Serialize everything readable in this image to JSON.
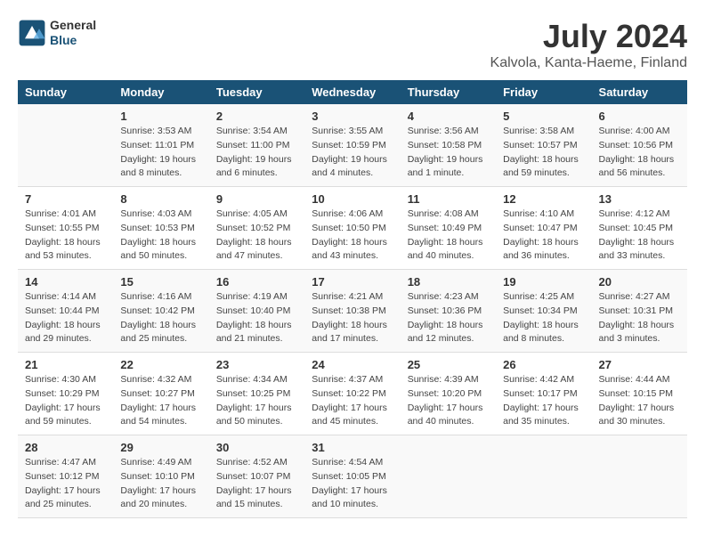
{
  "header": {
    "logo_general": "General",
    "logo_blue": "Blue",
    "month_title": "July 2024",
    "location": "Kalvola, Kanta-Haeme, Finland"
  },
  "days_of_week": [
    "Sunday",
    "Monday",
    "Tuesday",
    "Wednesday",
    "Thursday",
    "Friday",
    "Saturday"
  ],
  "weeks": [
    [
      {
        "day": "",
        "info": ""
      },
      {
        "day": "1",
        "info": "Sunrise: 3:53 AM\nSunset: 11:01 PM\nDaylight: 19 hours\nand 8 minutes."
      },
      {
        "day": "2",
        "info": "Sunrise: 3:54 AM\nSunset: 11:00 PM\nDaylight: 19 hours\nand 6 minutes."
      },
      {
        "day": "3",
        "info": "Sunrise: 3:55 AM\nSunset: 10:59 PM\nDaylight: 19 hours\nand 4 minutes."
      },
      {
        "day": "4",
        "info": "Sunrise: 3:56 AM\nSunset: 10:58 PM\nDaylight: 19 hours\nand 1 minute."
      },
      {
        "day": "5",
        "info": "Sunrise: 3:58 AM\nSunset: 10:57 PM\nDaylight: 18 hours\nand 59 minutes."
      },
      {
        "day": "6",
        "info": "Sunrise: 4:00 AM\nSunset: 10:56 PM\nDaylight: 18 hours\nand 56 minutes."
      }
    ],
    [
      {
        "day": "7",
        "info": "Sunrise: 4:01 AM\nSunset: 10:55 PM\nDaylight: 18 hours\nand 53 minutes."
      },
      {
        "day": "8",
        "info": "Sunrise: 4:03 AM\nSunset: 10:53 PM\nDaylight: 18 hours\nand 50 minutes."
      },
      {
        "day": "9",
        "info": "Sunrise: 4:05 AM\nSunset: 10:52 PM\nDaylight: 18 hours\nand 47 minutes."
      },
      {
        "day": "10",
        "info": "Sunrise: 4:06 AM\nSunset: 10:50 PM\nDaylight: 18 hours\nand 43 minutes."
      },
      {
        "day": "11",
        "info": "Sunrise: 4:08 AM\nSunset: 10:49 PM\nDaylight: 18 hours\nand 40 minutes."
      },
      {
        "day": "12",
        "info": "Sunrise: 4:10 AM\nSunset: 10:47 PM\nDaylight: 18 hours\nand 36 minutes."
      },
      {
        "day": "13",
        "info": "Sunrise: 4:12 AM\nSunset: 10:45 PM\nDaylight: 18 hours\nand 33 minutes."
      }
    ],
    [
      {
        "day": "14",
        "info": "Sunrise: 4:14 AM\nSunset: 10:44 PM\nDaylight: 18 hours\nand 29 minutes."
      },
      {
        "day": "15",
        "info": "Sunrise: 4:16 AM\nSunset: 10:42 PM\nDaylight: 18 hours\nand 25 minutes."
      },
      {
        "day": "16",
        "info": "Sunrise: 4:19 AM\nSunset: 10:40 PM\nDaylight: 18 hours\nand 21 minutes."
      },
      {
        "day": "17",
        "info": "Sunrise: 4:21 AM\nSunset: 10:38 PM\nDaylight: 18 hours\nand 17 minutes."
      },
      {
        "day": "18",
        "info": "Sunrise: 4:23 AM\nSunset: 10:36 PM\nDaylight: 18 hours\nand 12 minutes."
      },
      {
        "day": "19",
        "info": "Sunrise: 4:25 AM\nSunset: 10:34 PM\nDaylight: 18 hours\nand 8 minutes."
      },
      {
        "day": "20",
        "info": "Sunrise: 4:27 AM\nSunset: 10:31 PM\nDaylight: 18 hours\nand 3 minutes."
      }
    ],
    [
      {
        "day": "21",
        "info": "Sunrise: 4:30 AM\nSunset: 10:29 PM\nDaylight: 17 hours\nand 59 minutes."
      },
      {
        "day": "22",
        "info": "Sunrise: 4:32 AM\nSunset: 10:27 PM\nDaylight: 17 hours\nand 54 minutes."
      },
      {
        "day": "23",
        "info": "Sunrise: 4:34 AM\nSunset: 10:25 PM\nDaylight: 17 hours\nand 50 minutes."
      },
      {
        "day": "24",
        "info": "Sunrise: 4:37 AM\nSunset: 10:22 PM\nDaylight: 17 hours\nand 45 minutes."
      },
      {
        "day": "25",
        "info": "Sunrise: 4:39 AM\nSunset: 10:20 PM\nDaylight: 17 hours\nand 40 minutes."
      },
      {
        "day": "26",
        "info": "Sunrise: 4:42 AM\nSunset: 10:17 PM\nDaylight: 17 hours\nand 35 minutes."
      },
      {
        "day": "27",
        "info": "Sunrise: 4:44 AM\nSunset: 10:15 PM\nDaylight: 17 hours\nand 30 minutes."
      }
    ],
    [
      {
        "day": "28",
        "info": "Sunrise: 4:47 AM\nSunset: 10:12 PM\nDaylight: 17 hours\nand 25 minutes."
      },
      {
        "day": "29",
        "info": "Sunrise: 4:49 AM\nSunset: 10:10 PM\nDaylight: 17 hours\nand 20 minutes."
      },
      {
        "day": "30",
        "info": "Sunrise: 4:52 AM\nSunset: 10:07 PM\nDaylight: 17 hours\nand 15 minutes."
      },
      {
        "day": "31",
        "info": "Sunrise: 4:54 AM\nSunset: 10:05 PM\nDaylight: 17 hours\nand 10 minutes."
      },
      {
        "day": "",
        "info": ""
      },
      {
        "day": "",
        "info": ""
      },
      {
        "day": "",
        "info": ""
      }
    ]
  ]
}
